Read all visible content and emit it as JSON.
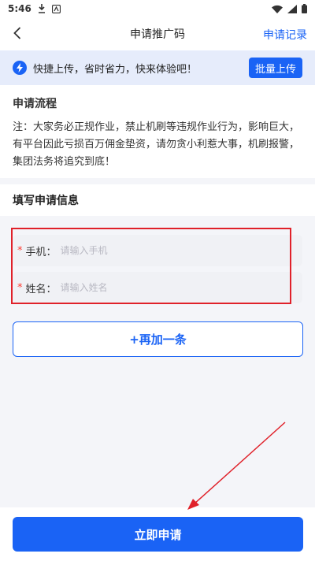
{
  "status_bar": {
    "time": "5:46"
  },
  "nav": {
    "title": "申请推广码",
    "action": "申请记录"
  },
  "banner": {
    "text": "快捷上传，省时省力，快来体验吧！",
    "button": "批量上传"
  },
  "process": {
    "title": "申请流程",
    "note": "注：大家务必正规作业，禁止机刷等违规作业行为，影响巨大，有平台因此亏损百万佣金垫资，请勿贪小利惹大事，机刷报警，集团法务将追究到底！"
  },
  "apply": {
    "title": "填写申请信息",
    "required_mark": "*",
    "phone_label": "手机：",
    "phone_placeholder": "请输入手机",
    "name_label": "姓名：",
    "name_placeholder": "请输入姓名",
    "add_more": "+再加一条"
  },
  "submit": {
    "label": "立即申请"
  },
  "colors": {
    "accent": "#1a63f5",
    "highlight": "#e0212a",
    "required": "#ff3b30"
  },
  "icons": [
    "download-icon",
    "app-icon",
    "wifi-icon",
    "signal-icon",
    "battery-icon",
    "back-icon",
    "bolt-icon"
  ]
}
